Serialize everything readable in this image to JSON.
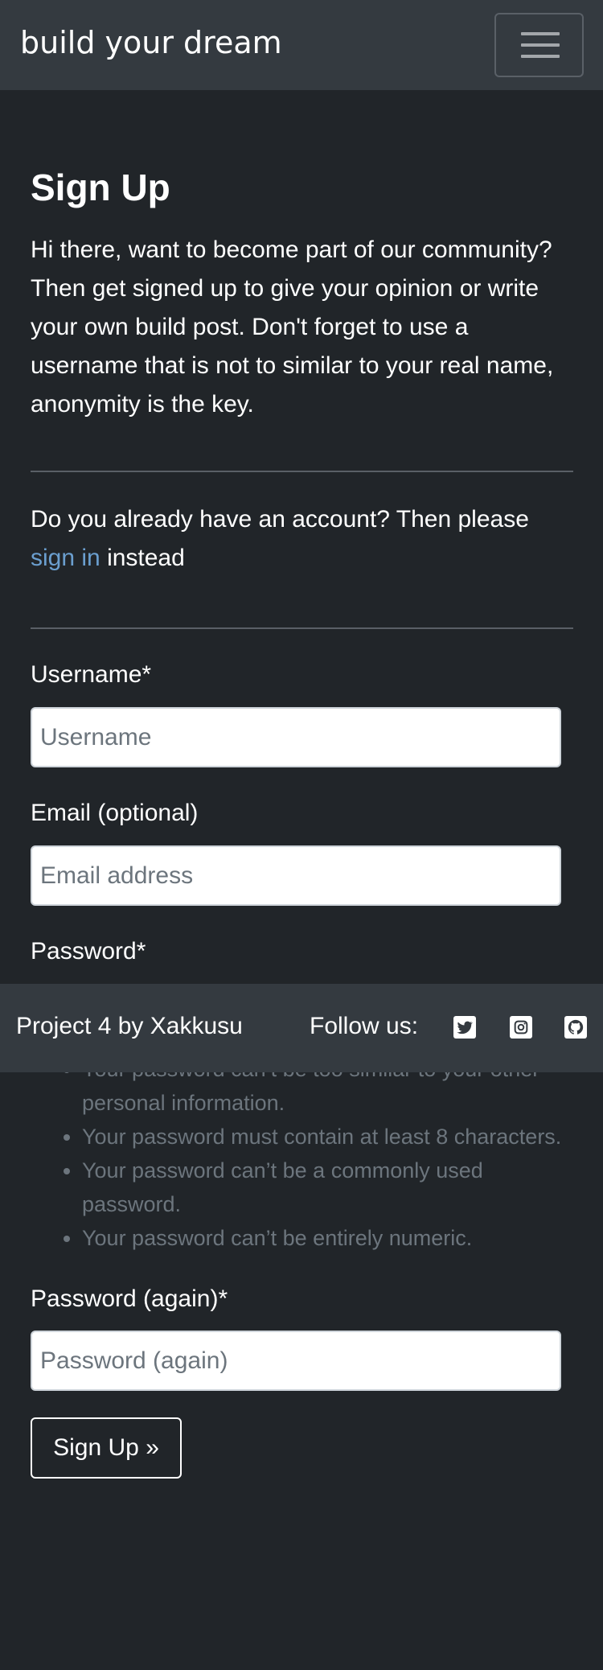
{
  "navbar": {
    "brand": "build your dream",
    "toggler_icon": "hamburger-menu-icon"
  },
  "page": {
    "title": "Sign Up",
    "intro": "Hi there, want to become part of our community? Then get signed up to give your opinion or write your own build post. Don't forget to use a username that is not to similar to your real name, anonymity is the key.",
    "account_prefix": "Do you already have an account? Then please",
    "account_link": "sign in",
    "account_suffix": "instead"
  },
  "form": {
    "username_label": "Username*",
    "username_placeholder": "Username",
    "email_label": "Email (optional)",
    "email_placeholder": "Email address",
    "password_label": "Password*",
    "password_help": [
      "Your password can’t be too similar to your other personal information.",
      "Your password must contain at least 8 characters.",
      "Your password can’t be a commonly used password.",
      "Your password can’t be entirely numeric."
    ],
    "password2_label": "Password (again)*",
    "password2_placeholder": "Password (again)",
    "submit_label": "Sign Up »"
  },
  "footer": {
    "credit": "Project 4 by Xakkusu",
    "follow": "Follow us:",
    "social_icons": [
      "twitter-icon",
      "instagram-icon",
      "github-icon"
    ]
  },
  "colors": {
    "background": "#212529",
    "navbar": "#343a40",
    "link": "#6b9fcf",
    "muted": "#6c757d"
  }
}
